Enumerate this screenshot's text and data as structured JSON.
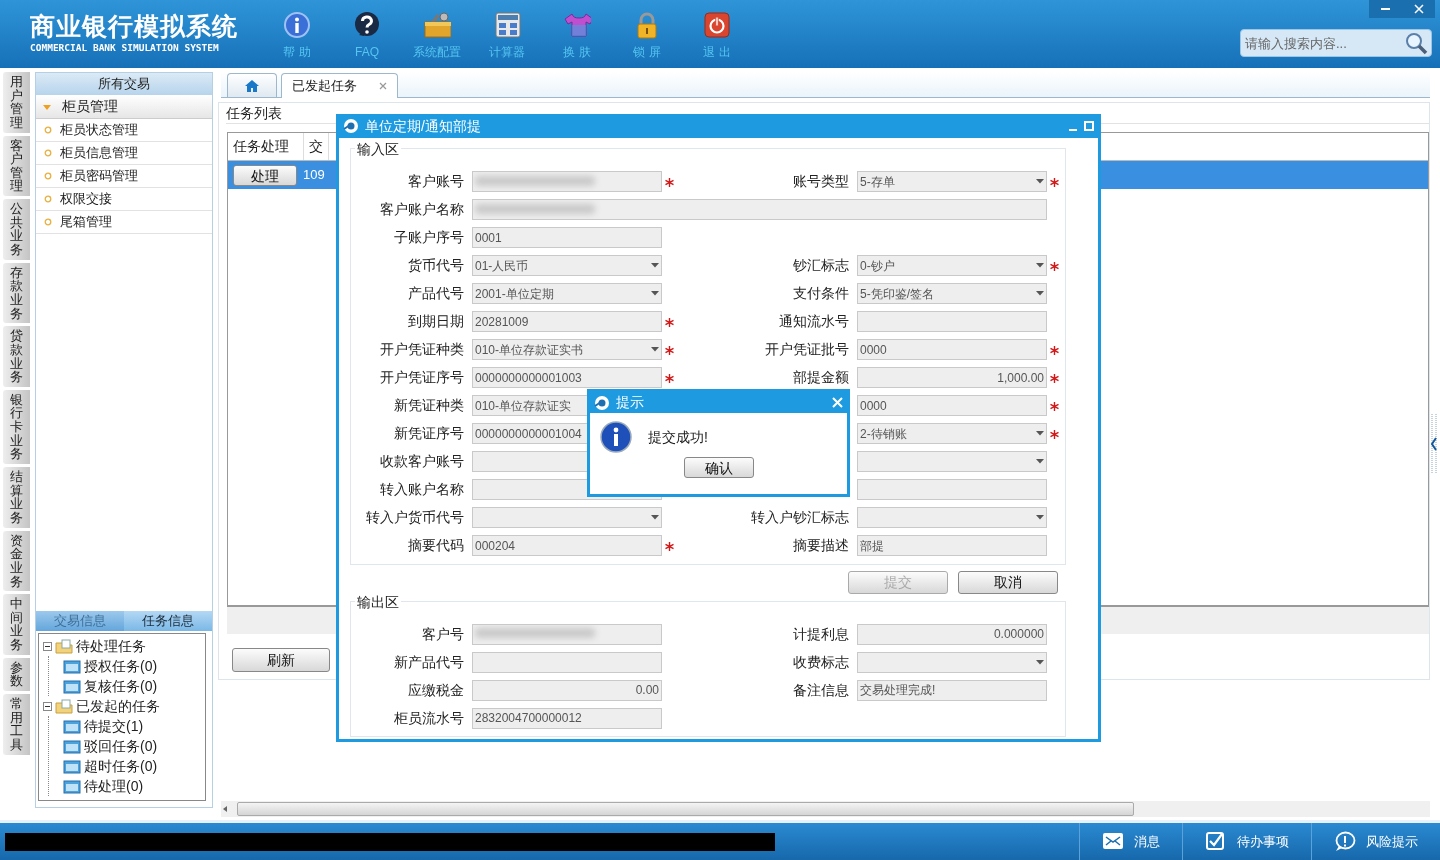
{
  "app": {
    "title": "商业银行模拟系统",
    "subtitle": "COMMERCIAL BANK SIMULATION SYSTEM"
  },
  "toolbar": [
    {
      "label": "帮 助",
      "kind": "info"
    },
    {
      "label": "FAQ",
      "kind": "faq"
    },
    {
      "label": "系统配置",
      "kind": "config"
    },
    {
      "label": "计算器",
      "kind": "calc"
    },
    {
      "label": "换 肤",
      "kind": "skin"
    },
    {
      "label": "锁 屏",
      "kind": "lock"
    },
    {
      "label": "退 出",
      "kind": "exit"
    }
  ],
  "search": {
    "placeholder": "请输入搜索内容..."
  },
  "side_tabs": [
    {
      "label": "用户管理"
    },
    {
      "label": "客户管理"
    },
    {
      "label": "公共业务"
    },
    {
      "label": "存款业务"
    },
    {
      "label": "贷款业务"
    },
    {
      "label": "银行卡业务"
    },
    {
      "label": "结算业务"
    },
    {
      "label": "资金业务"
    },
    {
      "label": "中间业务"
    },
    {
      "label": "参数"
    },
    {
      "label": "常用工具"
    }
  ],
  "menu": {
    "title": "所有交易",
    "group": {
      "label": "柜员管理",
      "expanded": true,
      "items": [
        "柜员状态管理",
        "柜员信息管理",
        "柜员密码管理",
        "权限交接",
        "尾箱管理"
      ]
    }
  },
  "info_tabs": [
    {
      "label": "交易信息",
      "selected": false
    },
    {
      "label": "任务信息",
      "selected": true
    }
  ],
  "task_tree": [
    {
      "label": "待处理任务",
      "expanded": true,
      "children": [
        {
          "label": "授权任务(0)"
        },
        {
          "label": "复核任务(0)"
        }
      ]
    },
    {
      "label": "已发起的任务",
      "expanded": true,
      "children": [
        {
          "label": "待提交(1)"
        },
        {
          "label": "驳回任务(0)"
        },
        {
          "label": "超时任务(0)"
        },
        {
          "label": "待处理(0)"
        }
      ]
    }
  ],
  "tabs": [
    {
      "kind": "home",
      "selected": false
    },
    {
      "kind": "page",
      "label": "已发起任务",
      "selected": true
    }
  ],
  "task_list": {
    "title": "任务列表",
    "columns": [
      "任务处理",
      "交"
    ],
    "rows": [
      {
        "action": "处理",
        "cell": "109",
        "selected": true
      }
    ],
    "refresh": "刷新"
  },
  "dialog": {
    "title": "单位定期/通知部提",
    "input_title": "输入区",
    "input_rows": [
      [
        {
          "label": "客户账号",
          "kind": "text",
          "redacted": true,
          "required": true
        },
        {
          "label": "账号类型",
          "kind": "select",
          "value": "5-存单",
          "required": true
        }
      ],
      [
        {
          "label": "客户账户名称",
          "kind": "wide",
          "redacted": true
        }
      ],
      [
        {
          "label": "子账户序号",
          "kind": "text",
          "value": "0001"
        }
      ],
      [
        {
          "label": "货币代号",
          "kind": "select",
          "value": "01-人民币"
        },
        {
          "label": "钞汇标志",
          "kind": "select",
          "value": "0-钞户",
          "required": true
        }
      ],
      [
        {
          "label": "产品代号",
          "kind": "select",
          "value": "2001-单位定期"
        },
        {
          "label": "支付条件",
          "kind": "select",
          "value": "5-凭印鉴/签名"
        }
      ],
      [
        {
          "label": "到期日期",
          "kind": "text",
          "value": "20281009",
          "required": true
        },
        {
          "label": "通知流水号",
          "kind": "text"
        }
      ],
      [
        {
          "label": "开户凭证种类",
          "kind": "select",
          "value": "010-单位存款证实书",
          "required": true
        },
        {
          "label": "开户凭证批号",
          "kind": "text",
          "value": "0000",
          "required": true
        }
      ],
      [
        {
          "label": "开户凭证序号",
          "kind": "text",
          "value": "0000000000001003",
          "required": true
        },
        {
          "label": "部提金额",
          "kind": "text",
          "value": "1,000.00",
          "numeric": true,
          "required": true
        }
      ],
      [
        {
          "label": "新凭证种类",
          "kind": "text",
          "value": "010-单位存款证实"
        },
        {
          "kind": "text",
          "value": "0000",
          "required": true
        }
      ],
      [
        {
          "label": "新凭证序号",
          "kind": "text",
          "value": "0000000000001004"
        },
        {
          "kind": "select",
          "value": "2-待销账",
          "required": true
        }
      ],
      [
        {
          "label": "收款客户账号",
          "kind": "text"
        },
        {
          "kind": "select"
        }
      ],
      [
        {
          "label": "转入账户名称",
          "kind": "text"
        },
        {
          "kind": "text"
        }
      ],
      [
        {
          "label": "转入户货币代号",
          "kind": "select"
        },
        {
          "label": "转入户钞汇标志",
          "kind": "select"
        }
      ],
      [
        {
          "label": "摘要代码",
          "kind": "text",
          "value": "000204",
          "required": true
        },
        {
          "label": "摘要描述",
          "kind": "text",
          "value": "部提"
        }
      ]
    ],
    "buttons": [
      {
        "label": "提交",
        "disabled": true
      },
      {
        "label": "取消",
        "disabled": false
      }
    ],
    "output_title": "输出区",
    "output_rows": [
      [
        {
          "label": "客户号",
          "kind": "text",
          "redacted": true
        },
        {
          "label": "计提利息",
          "kind": "text",
          "value": "0.000000",
          "numeric": true
        }
      ],
      [
        {
          "label": "新产品代号",
          "kind": "text"
        },
        {
          "label": "收费标志",
          "kind": "select"
        }
      ],
      [
        {
          "label": "应缴税金",
          "kind": "text",
          "value": "0.00",
          "numeric": true
        },
        {
          "label": "备注信息",
          "kind": "text",
          "value": "交易处理完成!"
        }
      ],
      [
        {
          "label": "柜员流水号",
          "kind": "text",
          "value": "2832004700000012"
        }
      ]
    ]
  },
  "alert": {
    "title": "提示",
    "message": "提交成功!",
    "button": "确认"
  },
  "status_bar": {
    "items": [
      {
        "label": "消息",
        "kind": "message"
      },
      {
        "label": "待办事项",
        "kind": "todo"
      },
      {
        "label": "风险提示",
        "kind": "risk"
      }
    ]
  }
}
